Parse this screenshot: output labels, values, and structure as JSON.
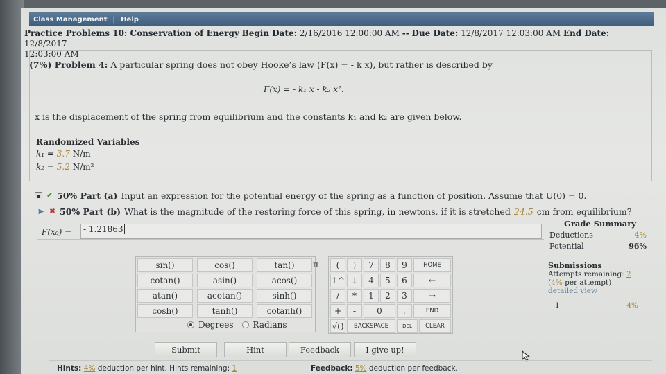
{
  "menu": {
    "class_management": "Class Management",
    "separator": "|",
    "help": "Help"
  },
  "header": {
    "assignment": "Practice Problems 10: Conservation of Energy",
    "begin_label": "Begin Date:",
    "begin_date": "2/16/2016 12:00:00 AM",
    "sep": "--",
    "due_label": "Due Date:",
    "due_date": "12/8/2017 12:03:00 AM",
    "end_label": "End Date:",
    "end_date": "12/8/2017",
    "end_time": "12:03:00 AM"
  },
  "problem": {
    "title_prefix": "(7%) Problem 4:",
    "title_text": "A particular spring does not obey Hooke’s law (F(x) = - k x), but rather is described by",
    "equation": "F(x) = - k₁ x - k₂ x².",
    "description": "x is the displacement of the spring from equilibrium and the constants k₁ and k₂ are given below."
  },
  "randomized": {
    "title": "Randomized Variables",
    "k1_label": "k₁ =",
    "k1_value": "3.7",
    "k1_unit": "N/m",
    "k2_label": "k₂ =",
    "k2_value": "5.2",
    "k2_unit": "N/m²"
  },
  "parts": {
    "a_pct": "50% Part (a)",
    "a_text": "Input an expression for the potential energy of the spring as a function of position. Assume that U(0) = 0.",
    "b_pct": "50% Part (b)",
    "b_text_1": "What is the magnitude of the restoring force of this spring, in newtons, if it is stretched",
    "b_value": "24.5",
    "b_text_2": "cm from equilibrium?"
  },
  "answer": {
    "label": "F(x₀) =",
    "value": "- 1.21863"
  },
  "grade_summary": {
    "title": "Grade Summary",
    "deductions_label": "Deductions",
    "deductions_value": "4%",
    "potential_label": "Potential",
    "potential_value": "96%"
  },
  "submissions": {
    "title": "Submissions",
    "attempts_label": "Attempts remaining:",
    "attempts_value": "2",
    "per_attempt_open": "(",
    "per_attempt_value": "4%",
    "per_attempt_text": "per attempt)",
    "detailed_view": "detailed view",
    "row_num": "1",
    "row_value": "4%"
  },
  "keypad": {
    "r1": [
      "sin()",
      "cos()",
      "tan()"
    ],
    "r2": [
      "cotan()",
      "asin()",
      "acos()"
    ],
    "r3": [
      "atan()",
      "acotan()",
      "sinh()"
    ],
    "r4": [
      "cosh()",
      "tanh()",
      "cotanh()"
    ],
    "pi": "π",
    "degrees": "Degrees",
    "radians": "Radians"
  },
  "numpad": {
    "paren_open": "(",
    "paren_close": ")",
    "n7": "7",
    "n8": "8",
    "n9": "9",
    "home": "HOME",
    "up": "↑^",
    "arrow_block": "↓",
    "n4": "4",
    "n5": "5",
    "n6": "6",
    "left": "←",
    "div": "/",
    "mul": "*",
    "n1": "1",
    "n2": "2",
    "n3": "3",
    "right": "→",
    "plus": "+",
    "minus": "-",
    "n0": "0",
    "dot": ".",
    "end": "END",
    "sqrt": "√()",
    "backspace": "BACKSPACE",
    "del": "DEL",
    "clear": "CLEAR"
  },
  "buttons": {
    "submit": "Submit",
    "hint": "Hint",
    "feedback": "Feedback",
    "give_up": "I give up!"
  },
  "hints": {
    "label": "Hints:",
    "pct": "4%",
    "text": "deduction per hint. Hints remaining:",
    "remaining": "1"
  },
  "feedback": {
    "label": "Feedback:",
    "pct": "5%",
    "text": "deduction per feedback."
  },
  "colors": {
    "menubar": "#46647f",
    "accent_var": "#a58a3c",
    "link": "#5f7b9a"
  }
}
